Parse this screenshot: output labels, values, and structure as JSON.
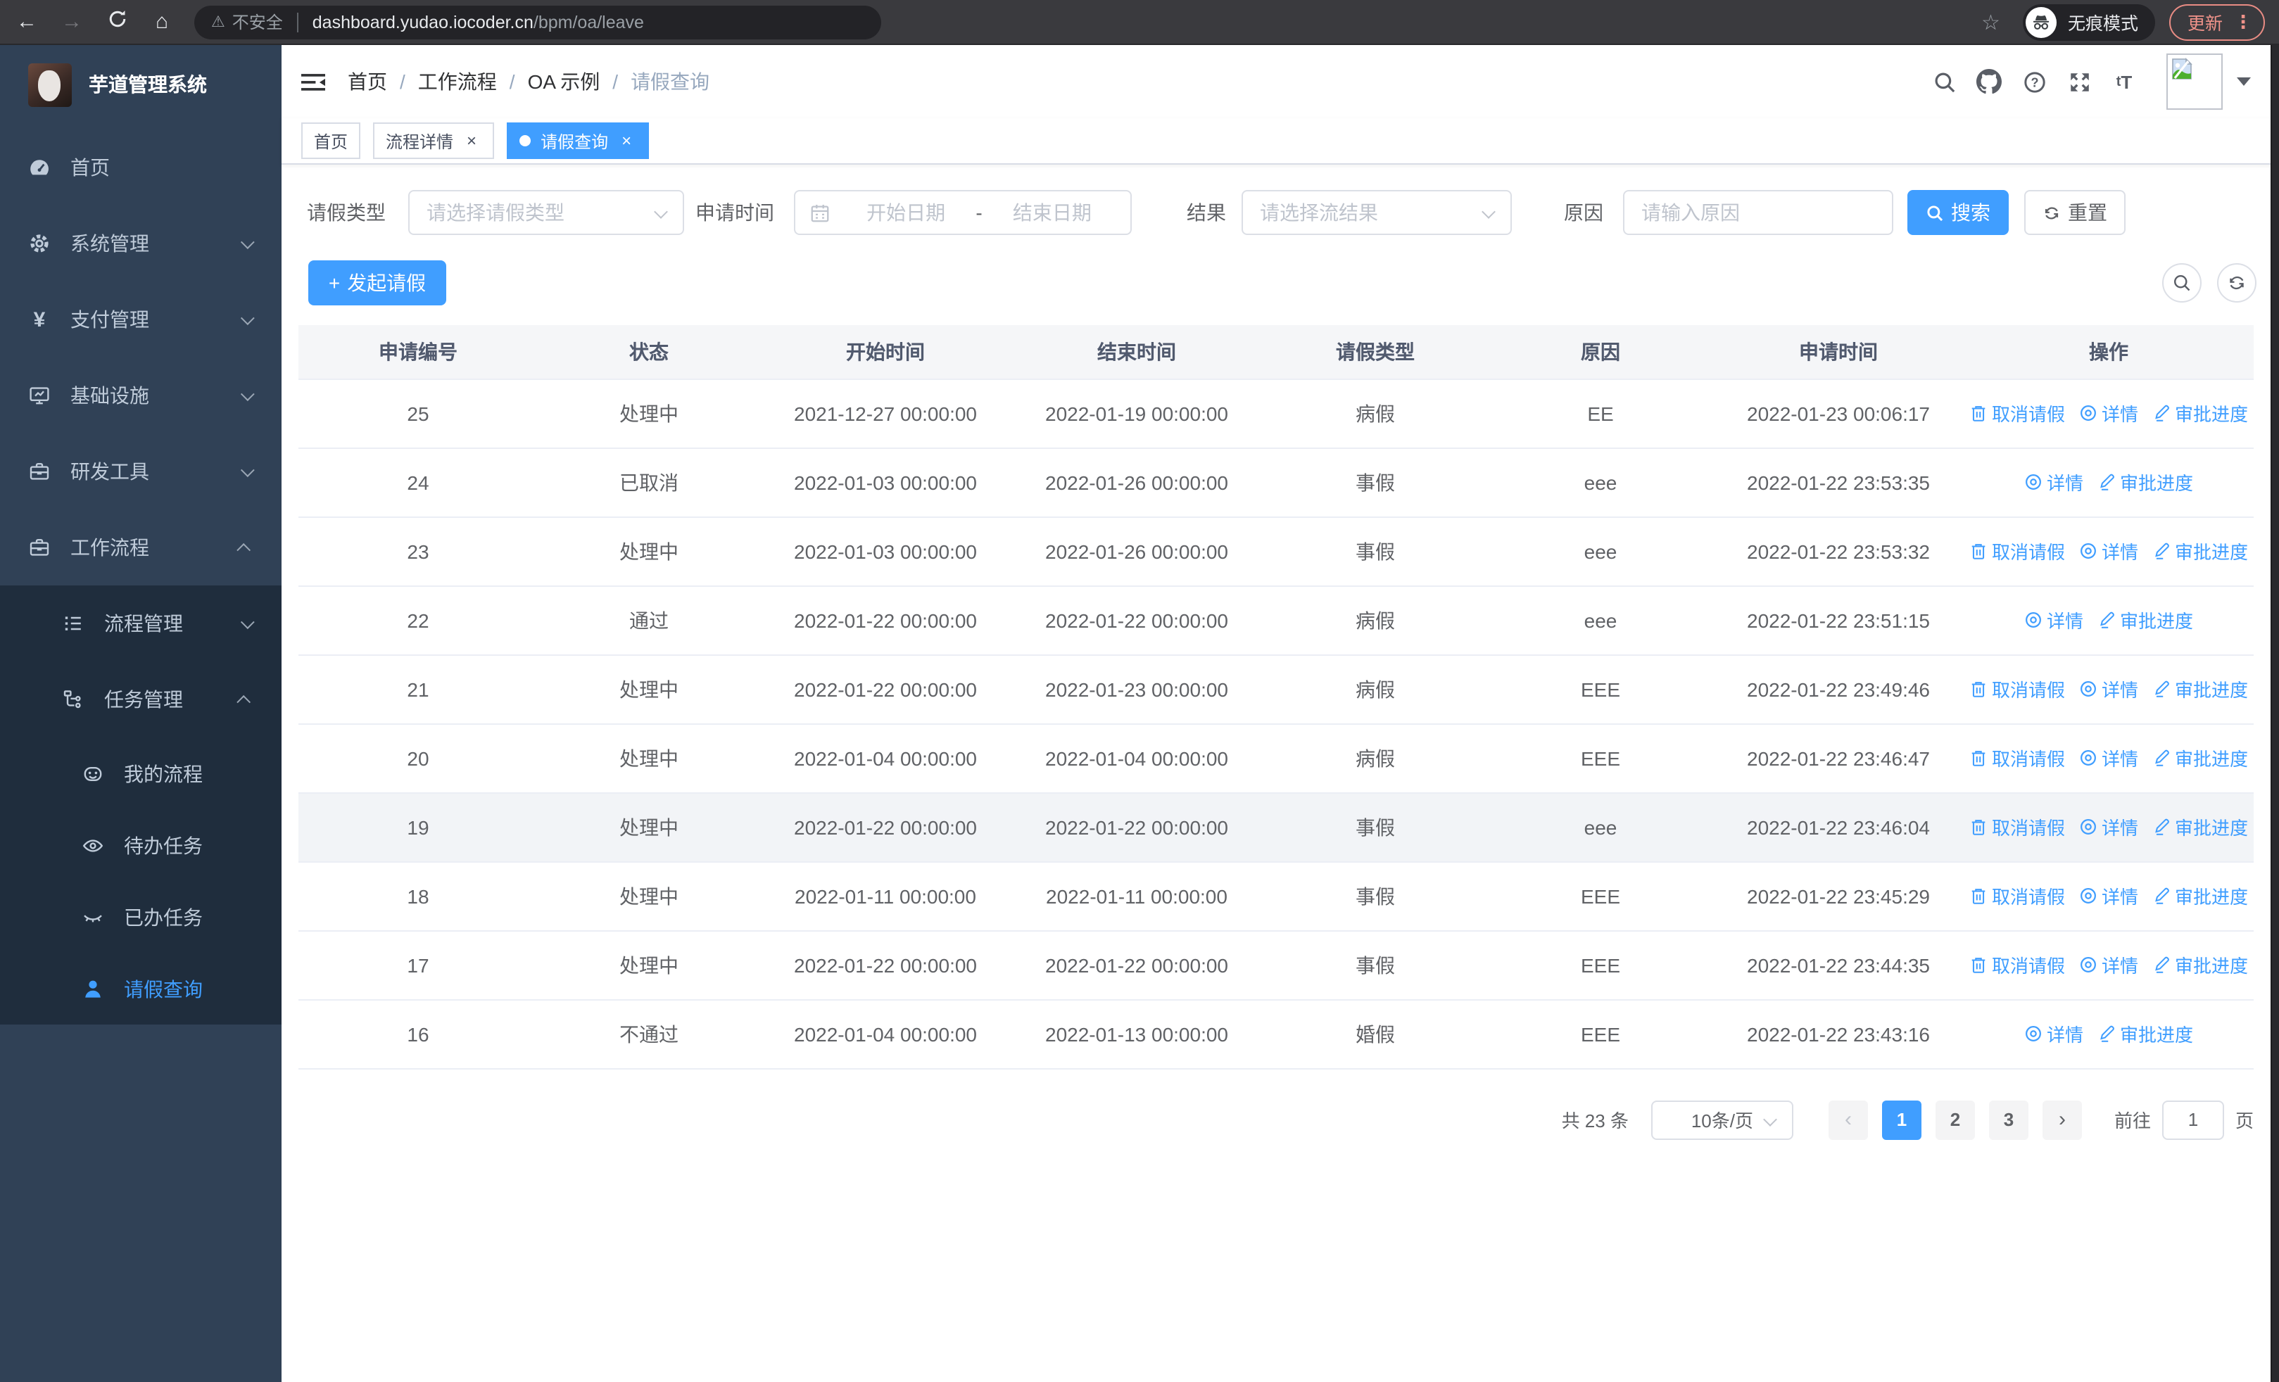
{
  "browser": {
    "security_label": "不安全",
    "url_host": "dashboard.yudao.iocoder.cn",
    "url_path": "/bpm/oa/leave",
    "incognito_label": "无痕模式",
    "update_label": "更新"
  },
  "icons": {
    "back": "←",
    "forward": "→",
    "home": "⌂",
    "warning": "⚠",
    "star": "☆",
    "menu_dots": "⋮",
    "close": "×",
    "prev": "‹",
    "next": "›"
  },
  "sidebar": {
    "title": "芋道管理系统",
    "items": [
      {
        "label": "首页",
        "icon": "dashboard-icon"
      },
      {
        "label": "系统管理",
        "icon": "gear-icon"
      },
      {
        "label": "支付管理",
        "icon": "yen-icon",
        "yen_glyph": "¥"
      },
      {
        "label": "基础设施",
        "icon": "monitor-icon"
      },
      {
        "label": "研发工具",
        "icon": "toolbox-icon"
      },
      {
        "label": "工作流程",
        "icon": "briefcase-icon"
      },
      {
        "label": "流程管理",
        "icon": "process-list-icon"
      },
      {
        "label": "任务管理",
        "icon": "task-tree-icon"
      },
      {
        "label": "我的流程",
        "icon": "face-icon"
      },
      {
        "label": "待办任务",
        "icon": "eye-open-icon"
      },
      {
        "label": "已办任务",
        "icon": "eye-closed-icon"
      },
      {
        "label": "请假查询",
        "icon": "user-icon"
      }
    ]
  },
  "navbar": {
    "breadcrumb": [
      "首页",
      "工作流程",
      "OA 示例",
      "请假查询"
    ],
    "separator": "/",
    "font_size_glyph_small": "t",
    "font_size_glyph_big": "T"
  },
  "tabs": [
    {
      "label": "首页"
    },
    {
      "label": "流程详情"
    },
    {
      "label": "请假查询"
    }
  ],
  "filters": {
    "leave_type_label": "请假类型",
    "leave_type_placeholder": "请选择请假类型",
    "apply_time_label": "申请时间",
    "date_start_placeholder": "开始日期",
    "date_separator": "-",
    "date_end_placeholder": "结束日期",
    "result_label": "结果",
    "result_placeholder": "请选择流结果",
    "reason_label": "原因",
    "reason_placeholder": "请输入原因",
    "search_label": "搜索",
    "reset_label": "重置"
  },
  "toolbar": {
    "create_label": "发起请假"
  },
  "table": {
    "columns": [
      "申请编号",
      "状态",
      "开始时间",
      "结束时间",
      "请假类型",
      "原因",
      "申请时间",
      "操作"
    ],
    "action_labels": {
      "cancel": "取消请假",
      "detail": "详情",
      "progress": "审批进度"
    },
    "rows": [
      {
        "id": "25",
        "status": "处理中",
        "start": "2021-12-27 00:00:00",
        "end": "2022-01-19 00:00:00",
        "type": "病假",
        "reason": "EE",
        "applied": "2022-01-23 00:06:17"
      },
      {
        "id": "24",
        "status": "已取消",
        "start": "2022-01-03 00:00:00",
        "end": "2022-01-26 00:00:00",
        "type": "事假",
        "reason": "eee",
        "applied": "2022-01-22 23:53:35"
      },
      {
        "id": "23",
        "status": "处理中",
        "start": "2022-01-03 00:00:00",
        "end": "2022-01-26 00:00:00",
        "type": "事假",
        "reason": "eee",
        "applied": "2022-01-22 23:53:32"
      },
      {
        "id": "22",
        "status": "通过",
        "start": "2022-01-22 00:00:00",
        "end": "2022-01-22 00:00:00",
        "type": "病假",
        "reason": "eee",
        "applied": "2022-01-22 23:51:15"
      },
      {
        "id": "21",
        "status": "处理中",
        "start": "2022-01-22 00:00:00",
        "end": "2022-01-23 00:00:00",
        "type": "病假",
        "reason": "EEE",
        "applied": "2022-01-22 23:49:46"
      },
      {
        "id": "20",
        "status": "处理中",
        "start": "2022-01-04 00:00:00",
        "end": "2022-01-04 00:00:00",
        "type": "病假",
        "reason": "EEE",
        "applied": "2022-01-22 23:46:47"
      },
      {
        "id": "19",
        "status": "处理中",
        "start": "2022-01-22 00:00:00",
        "end": "2022-01-22 00:00:00",
        "type": "事假",
        "reason": "eee",
        "applied": "2022-01-22 23:46:04"
      },
      {
        "id": "18",
        "status": "处理中",
        "start": "2022-01-11 00:00:00",
        "end": "2022-01-11 00:00:00",
        "type": "事假",
        "reason": "EEE",
        "applied": "2022-01-22 23:45:29"
      },
      {
        "id": "17",
        "status": "处理中",
        "start": "2022-01-22 00:00:00",
        "end": "2022-01-22 00:00:00",
        "type": "事假",
        "reason": "EEE",
        "applied": "2022-01-22 23:44:35"
      },
      {
        "id": "16",
        "status": "不通过",
        "start": "2022-01-04 00:00:00",
        "end": "2022-01-13 00:00:00",
        "type": "婚假",
        "reason": "EEE",
        "applied": "2022-01-22 23:43:16"
      }
    ]
  },
  "pagination": {
    "total_label": "共 23 条",
    "page_size_label": "10条/页",
    "pages": [
      "1",
      "2",
      "3"
    ],
    "active_page": "1",
    "goto_label": "前往",
    "goto_value": "1",
    "page_unit_label": "页"
  },
  "colors": {
    "accent_blue": "#409eff",
    "sidebar_bg": "#304156",
    "submenu_bg": "#1f2d3d",
    "update_red": "#f0938a"
  }
}
